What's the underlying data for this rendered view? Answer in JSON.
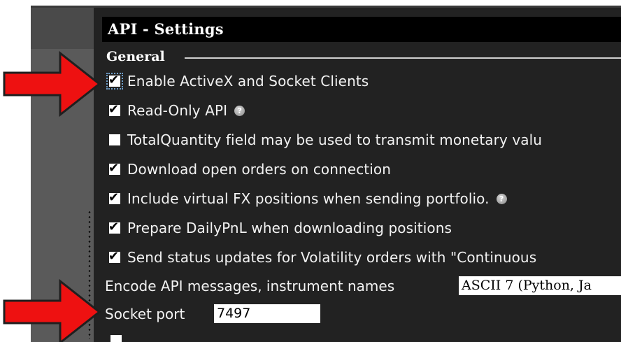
{
  "panel": {
    "title": "API - Settings",
    "section": "General"
  },
  "checkboxes": [
    {
      "label": "Enable ActiveX and Socket Clients",
      "checked": true,
      "help": false
    },
    {
      "label": "Read-Only API",
      "checked": true,
      "help": true
    },
    {
      "label": "TotalQuantity field may be used to transmit monetary valu",
      "checked": false,
      "help": false
    },
    {
      "label": "Download open orders on connection",
      "checked": true,
      "help": false
    },
    {
      "label": "Include virtual FX positions when sending portfolio.",
      "checked": true,
      "help": true
    },
    {
      "label": "Prepare DailyPnL when downloading positions",
      "checked": true,
      "help": false
    },
    {
      "label": "Send status updates for Volatility orders with \"Continuous",
      "checked": true,
      "help": false
    }
  ],
  "encoding": {
    "label": "Encode API messages, instrument names",
    "value": "ASCII 7 (Python, Ja"
  },
  "socket_port": {
    "label": "Socket port",
    "value": "7497"
  },
  "annotations": {
    "arrow_color": "#ee1111",
    "arrow_outline": "#1f1f1f"
  },
  "icons": {
    "check": "✔",
    "help": "?"
  }
}
